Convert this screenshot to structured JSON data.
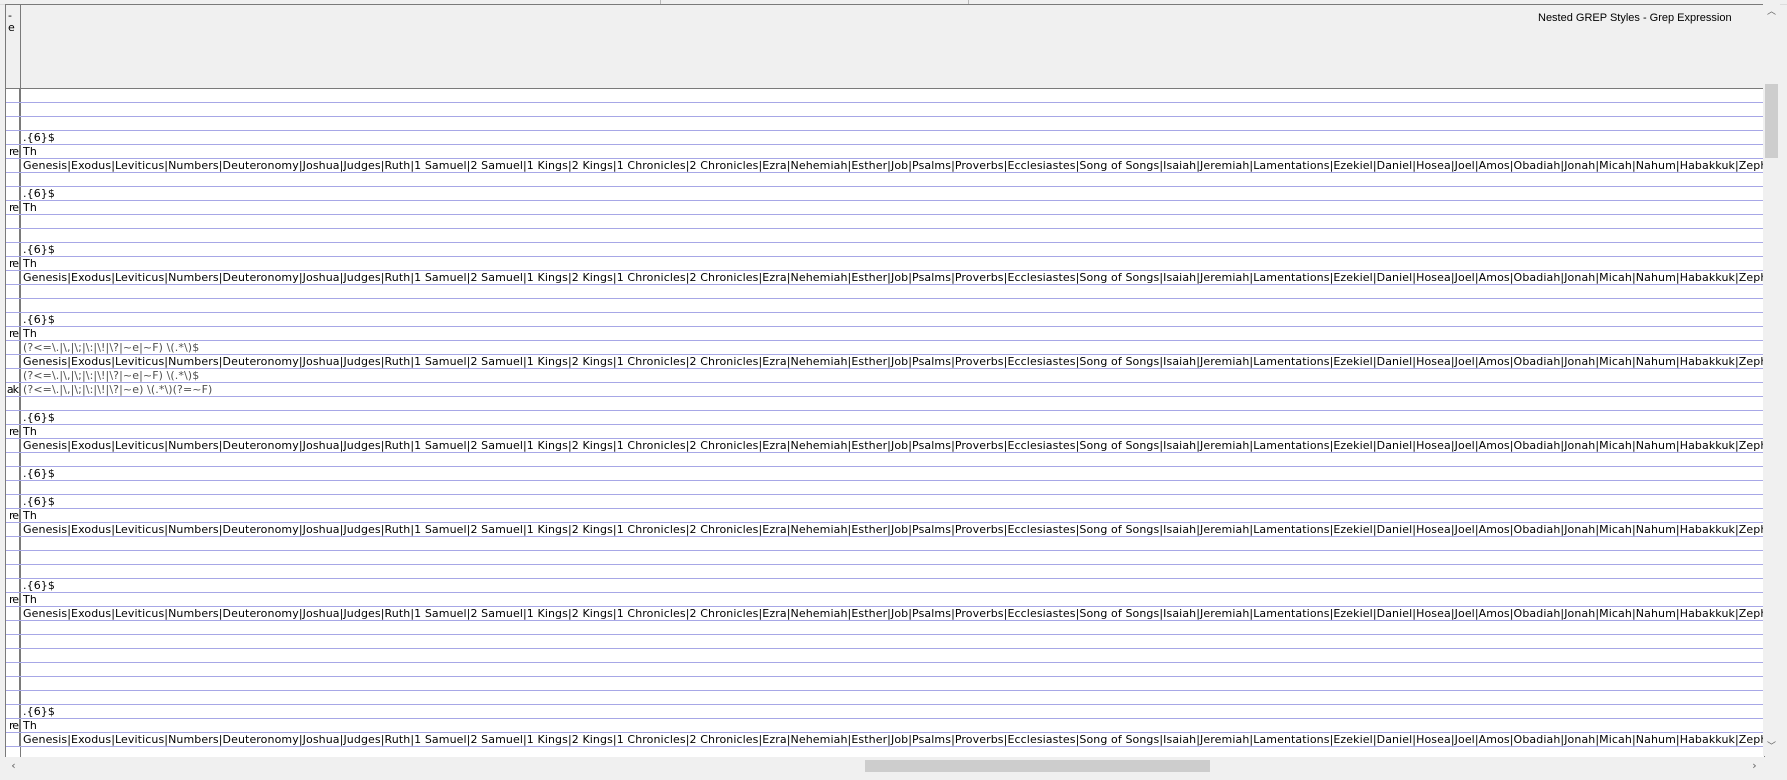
{
  "header": {
    "column_title": "Nested GREP Styles - Grep Expression",
    "row_header_fragments": [
      "-",
      "e"
    ]
  },
  "grid": {
    "rows": [
      {
        "head": "",
        "text": ""
      },
      {
        "head": "",
        "text": ""
      },
      {
        "head": "",
        "text": ""
      },
      {
        "head": "",
        "text": ".{6}$"
      },
      {
        "head": "re",
        "text": "Th"
      },
      {
        "head": "",
        "text": "Genesis|Exodus|Leviticus|Numbers|Deuteronomy|Joshua|Judges|Ruth|1 Samuel|2 Samuel|1 Kings|2 Kings|1 Chronicles|2 Chronicles|Ezra|Nehemiah|Esther|Job|Psalms|Proverbs|Ecclesiastes|Song of Songs|Isaiah|Jeremiah|Lamentations|Ezekiel|Daniel|Hosea|Joel|Amos|Obadiah|Jonah|Micah|Nahum|Habakkuk|Zephaniah|Hag"
      },
      {
        "head": "",
        "text": ""
      },
      {
        "head": "",
        "text": ".{6}$"
      },
      {
        "head": "re",
        "text": "Th"
      },
      {
        "head": "",
        "text": ""
      },
      {
        "head": "",
        "text": ""
      },
      {
        "head": "",
        "text": ".{6}$"
      },
      {
        "head": "re",
        "text": "Th"
      },
      {
        "head": "",
        "text": "Genesis|Exodus|Leviticus|Numbers|Deuteronomy|Joshua|Judges|Ruth|1 Samuel|2 Samuel|1 Kings|2 Kings|1 Chronicles|2 Chronicles|Ezra|Nehemiah|Esther|Job|Psalms|Proverbs|Ecclesiastes|Song of Songs|Isaiah|Jeremiah|Lamentations|Ezekiel|Daniel|Hosea|Joel|Amos|Obadiah|Jonah|Micah|Nahum|Habakkuk|Zephaniah|Hag"
      },
      {
        "head": "",
        "text": ""
      },
      {
        "head": "",
        "text": ""
      },
      {
        "head": "",
        "text": ".{6}$"
      },
      {
        "head": "re",
        "text": "Th"
      },
      {
        "head": "",
        "text": "(?<=\\.|\\,|\\;|\\:|\\!|\\?|~e|~F) \\(.*\\)$",
        "gray": true
      },
      {
        "head": "",
        "text": "Genesis|Exodus|Leviticus|Numbers|Deuteronomy|Joshua|Judges|Ruth|1 Samuel|2 Samuel|1 Kings|2 Kings|1 Chronicles|2 Chronicles|Ezra|Nehemiah|Esther|Job|Psalms|Proverbs|Ecclesiastes|Song of Songs|Isaiah|Jeremiah|Lamentations|Ezekiel|Daniel|Hosea|Joel|Amos|Obadiah|Jonah|Micah|Nahum|Habakkuk|Zephaniah|Hag"
      },
      {
        "head": "",
        "text": "(?<=\\.|\\,|\\;|\\:|\\!|\\?|~e|~F) \\(.*\\)$",
        "gray": true
      },
      {
        "head": "ak",
        "text": "(?<=\\.|\\,|\\;|\\:|\\!|\\?|~e) \\(.*\\)(?=~F)",
        "gray": true
      },
      {
        "head": "",
        "text": ""
      },
      {
        "head": "",
        "text": ".{6}$"
      },
      {
        "head": "re",
        "text": "Th"
      },
      {
        "head": "",
        "text": "Genesis|Exodus|Leviticus|Numbers|Deuteronomy|Joshua|Judges|Ruth|1 Samuel|2 Samuel|1 Kings|2 Kings|1 Chronicles|2 Chronicles|Ezra|Nehemiah|Esther|Job|Psalms|Proverbs|Ecclesiastes|Song of Songs|Isaiah|Jeremiah|Lamentations|Ezekiel|Daniel|Hosea|Joel|Amos|Obadiah|Jonah|Micah|Nahum|Habakkuk|Zephaniah|Hag"
      },
      {
        "head": "",
        "text": ""
      },
      {
        "head": "",
        "text": ".{6}$"
      },
      {
        "head": "",
        "text": ""
      },
      {
        "head": "",
        "text": ".{6}$"
      },
      {
        "head": "re",
        "text": "Th"
      },
      {
        "head": "",
        "text": "Genesis|Exodus|Leviticus|Numbers|Deuteronomy|Joshua|Judges|Ruth|1 Samuel|2 Samuel|1 Kings|2 Kings|1 Chronicles|2 Chronicles|Ezra|Nehemiah|Esther|Job|Psalms|Proverbs|Ecclesiastes|Song of Songs|Isaiah|Jeremiah|Lamentations|Ezekiel|Daniel|Hosea|Joel|Amos|Obadiah|Jonah|Micah|Nahum|Habakkuk|Zephaniah|Hag"
      },
      {
        "head": "",
        "text": ""
      },
      {
        "head": "",
        "text": ""
      },
      {
        "head": "",
        "text": ""
      },
      {
        "head": "",
        "text": ".{6}$"
      },
      {
        "head": "re",
        "text": "Th"
      },
      {
        "head": "",
        "text": "Genesis|Exodus|Leviticus|Numbers|Deuteronomy|Joshua|Judges|Ruth|1 Samuel|2 Samuel|1 Kings|2 Kings|1 Chronicles|2 Chronicles|Ezra|Nehemiah|Esther|Job|Psalms|Proverbs|Ecclesiastes|Song of Songs|Isaiah|Jeremiah|Lamentations|Ezekiel|Daniel|Hosea|Joel|Amos|Obadiah|Jonah|Micah|Nahum|Habakkuk|Zephaniah|Hag"
      },
      {
        "head": "",
        "text": ""
      },
      {
        "head": "",
        "text": ""
      },
      {
        "head": "",
        "text": ""
      },
      {
        "head": "",
        "text": ""
      },
      {
        "head": "",
        "text": ""
      },
      {
        "head": "",
        "text": ""
      },
      {
        "head": "",
        "text": ".{6}$"
      },
      {
        "head": "re",
        "text": "Th"
      },
      {
        "head": "",
        "text": "Genesis|Exodus|Leviticus|Numbers|Deuteronomy|Joshua|Judges|Ruth|1 Samuel|2 Samuel|1 Kings|2 Kings|1 Chronicles|2 Chronicles|Ezra|Nehemiah|Esther|Job|Psalms|Proverbs|Ecclesiastes|Song of Songs|Isaiah|Jeremiah|Lamentations|Ezekiel|Daniel|Hosea|Joel|Amos|Obadiah|Jonah|Micah|Nahum|Habakkuk|Zephaniah|Hag"
      }
    ]
  },
  "scrollbars": {
    "up_arrow_icon": "chevron-up-icon",
    "down_arrow_icon": "chevron-down-icon",
    "left_arrow_icon": "chevron-left-icon",
    "right_arrow_icon": "chevron-right-icon",
    "up_glyph": "︿",
    "down_glyph": "﹀",
    "left_glyph": "‹",
    "right_glyph": "›"
  },
  "colors": {
    "grid_line": "#a7a7e6",
    "header_bg": "#f0f0f0",
    "cell_bg": "#ffffff",
    "scroll_thumb": "#cdcdcd"
  }
}
